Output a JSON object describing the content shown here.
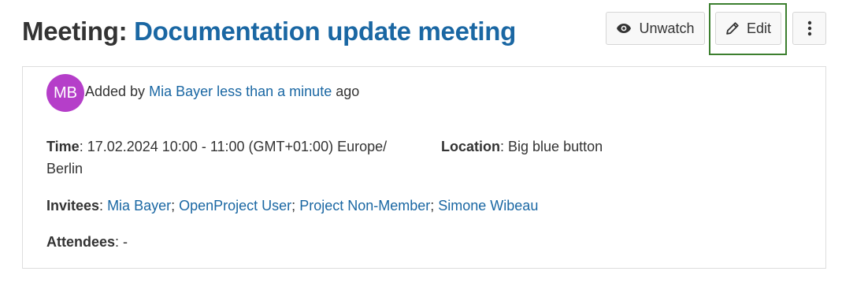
{
  "header": {
    "title_prefix": "Meeting:",
    "title_name": "Documentation update meeting"
  },
  "toolbar": {
    "unwatch_label": "Unwatch",
    "edit_label": "Edit",
    "more_icon": "kebab-vertical-icon",
    "eye_icon": "eye-icon",
    "pencil_icon": "pencil-icon"
  },
  "author": {
    "avatar_initials": "MB",
    "added_by_prefix": "Added by",
    "name": "Mia Bayer",
    "time_ago": "less than a minute",
    "ago_suffix": "ago"
  },
  "details": {
    "time_label": "Time",
    "time_value": "17.02.2024 10:00 - 11:00 (GMT+01:00) Europe/ Berlin",
    "location_label": "Location",
    "location_value": "Big blue button",
    "invitees_label": "Invitees",
    "invitees": [
      "Mia Bayer",
      "OpenProject User",
      "Project Non-Member",
      "Simone Wibeau"
    ],
    "attendees_label": "Attendees",
    "attendees_value": "-"
  },
  "colors": {
    "link": "#1a67a3",
    "avatar_bg": "#b53ec9",
    "edit_highlight": "#3c7f2f"
  }
}
